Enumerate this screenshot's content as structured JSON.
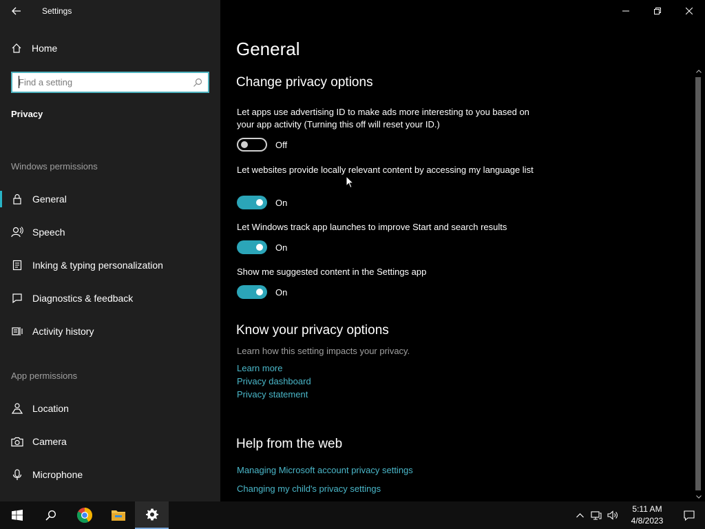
{
  "window": {
    "app_title": "Settings"
  },
  "sidebar": {
    "home_label": "Home",
    "search_placeholder": "Find a setting",
    "crumb": "Privacy",
    "section_windows": "Windows permissions",
    "section_app": "App permissions",
    "items": [
      {
        "label": "General",
        "icon": "lock-icon",
        "selected": true
      },
      {
        "label": "Speech",
        "icon": "speech-icon",
        "selected": false
      },
      {
        "label": "Inking & typing personalization",
        "icon": "inking-icon",
        "selected": false
      },
      {
        "label": "Diagnostics & feedback",
        "icon": "diagnostics-icon",
        "selected": false
      },
      {
        "label": "Activity history",
        "icon": "activity-history-icon",
        "selected": false
      },
      {
        "label": "Location",
        "icon": "location-icon",
        "selected": false
      },
      {
        "label": "Camera",
        "icon": "camera-icon",
        "selected": false
      },
      {
        "label": "Microphone",
        "icon": "microphone-icon",
        "selected": false
      }
    ]
  },
  "main": {
    "title": "General",
    "section1_title": "Change privacy options",
    "options": [
      {
        "desc": "Let apps use advertising ID to make ads more interesting to you based on your app activity (Turning this off will reset your ID.)",
        "state": "Off"
      },
      {
        "desc": "Let websites provide locally relevant content by accessing my language list",
        "state": "On"
      },
      {
        "desc": "Let Windows track app launches to improve Start and search results",
        "state": "On"
      },
      {
        "desc": "Show me suggested content in the Settings app",
        "state": "On"
      }
    ],
    "section2_title": "Know your privacy options",
    "section2_sub": "Learn how this setting impacts your privacy.",
    "links": [
      "Learn more",
      "Privacy dashboard",
      "Privacy statement"
    ],
    "section3_title": "Help from the web",
    "web_links": [
      "Managing Microsoft account privacy settings",
      "Changing my child's privacy settings"
    ]
  },
  "taskbar": {
    "time": "5:11 AM",
    "date": "4/8/2023"
  },
  "colors": {
    "accent": "#2ba5b8",
    "link": "#4ab7c9",
    "sidebar_bg": "#1f1f1f"
  }
}
